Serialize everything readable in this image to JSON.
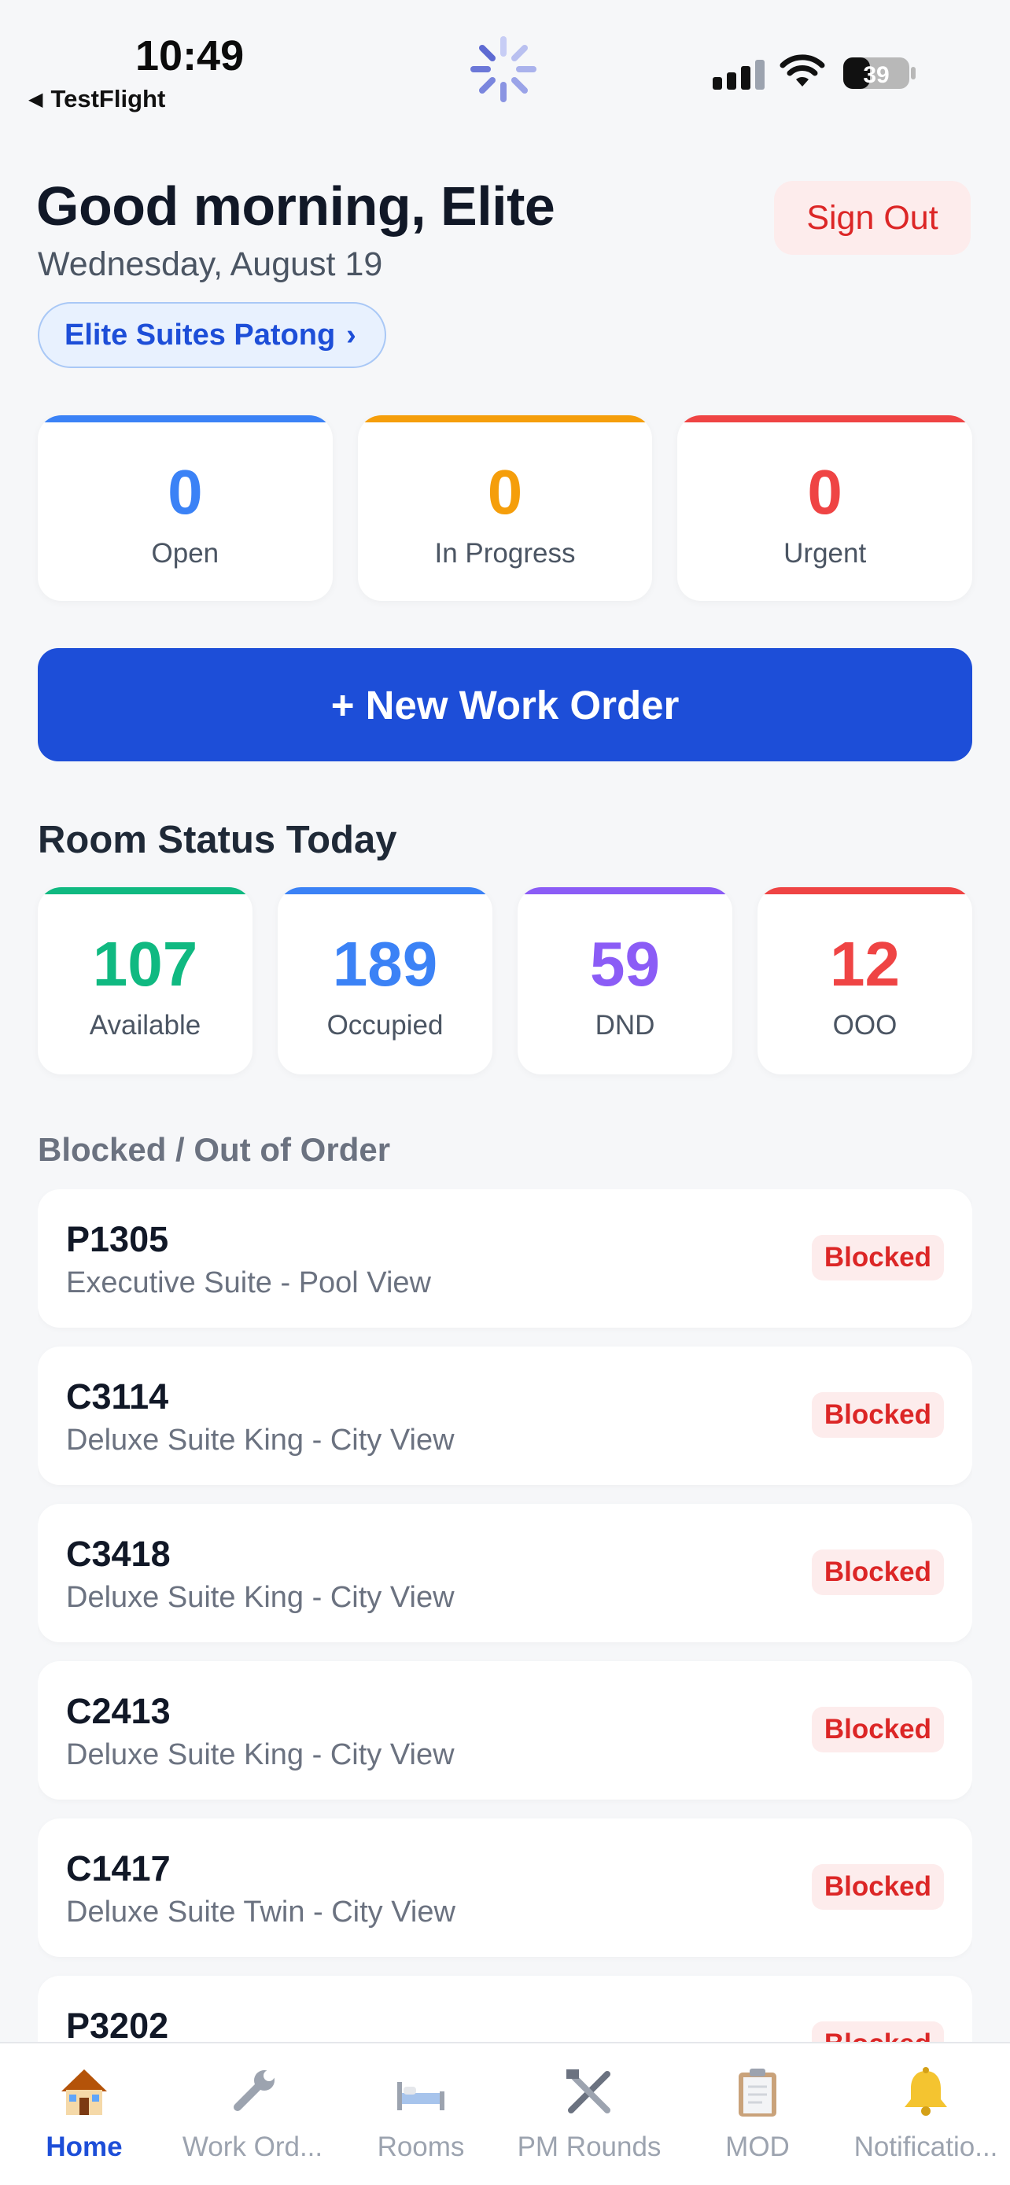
{
  "status_bar": {
    "time": "10:49",
    "back_app": "TestFlight",
    "battery": "39"
  },
  "header": {
    "greeting": "Good morning, Elite",
    "date": "Wednesday, August 19",
    "sign_out": "Sign Out",
    "property": "Elite Suites Patong",
    "property_chevron": "›"
  },
  "summary": [
    {
      "value": "0",
      "label": "Open",
      "color": "#3b82f6"
    },
    {
      "value": "0",
      "label": "In Progress",
      "color": "#f59e0b"
    },
    {
      "value": "0",
      "label": "Urgent",
      "color": "#ef4444"
    }
  ],
  "new_work_order": "+ New Work Order",
  "room_status": {
    "title": "Room Status Today",
    "cards": [
      {
        "value": "107",
        "label": "Available",
        "color": "#10b981"
      },
      {
        "value": "189",
        "label": "Occupied",
        "color": "#3b82f6"
      },
      {
        "value": "59",
        "label": "DND",
        "color": "#8b5cf6"
      },
      {
        "value": "12",
        "label": "OOO",
        "color": "#ef4444"
      }
    ]
  },
  "blocked": {
    "title": "Blocked / Out of Order",
    "items": [
      {
        "code": "P1305",
        "desc": "Executive Suite - Pool View",
        "status": "Blocked"
      },
      {
        "code": "C3114",
        "desc": "Deluxe Suite King - City View",
        "status": "Blocked"
      },
      {
        "code": "C3418",
        "desc": "Deluxe Suite King - City View",
        "status": "Blocked"
      },
      {
        "code": "C2413",
        "desc": "Deluxe Suite King - City View",
        "status": "Blocked"
      },
      {
        "code": "C1417",
        "desc": "Deluxe Suite Twin - City View",
        "status": "Blocked"
      },
      {
        "code": "P3202",
        "desc": "",
        "status": "Blocked"
      }
    ]
  },
  "tabs": [
    {
      "label": "Home",
      "icon": "house-icon",
      "active": true
    },
    {
      "label": "Work Ord...",
      "icon": "wrench-icon",
      "active": false
    },
    {
      "label": "Rooms",
      "icon": "bed-icon",
      "active": false
    },
    {
      "label": "PM Rounds",
      "icon": "tools-icon",
      "active": false
    },
    {
      "label": "MOD",
      "icon": "clipboard-icon",
      "active": false
    },
    {
      "label": "Notificatio...",
      "icon": "bell-icon",
      "active": false
    }
  ]
}
